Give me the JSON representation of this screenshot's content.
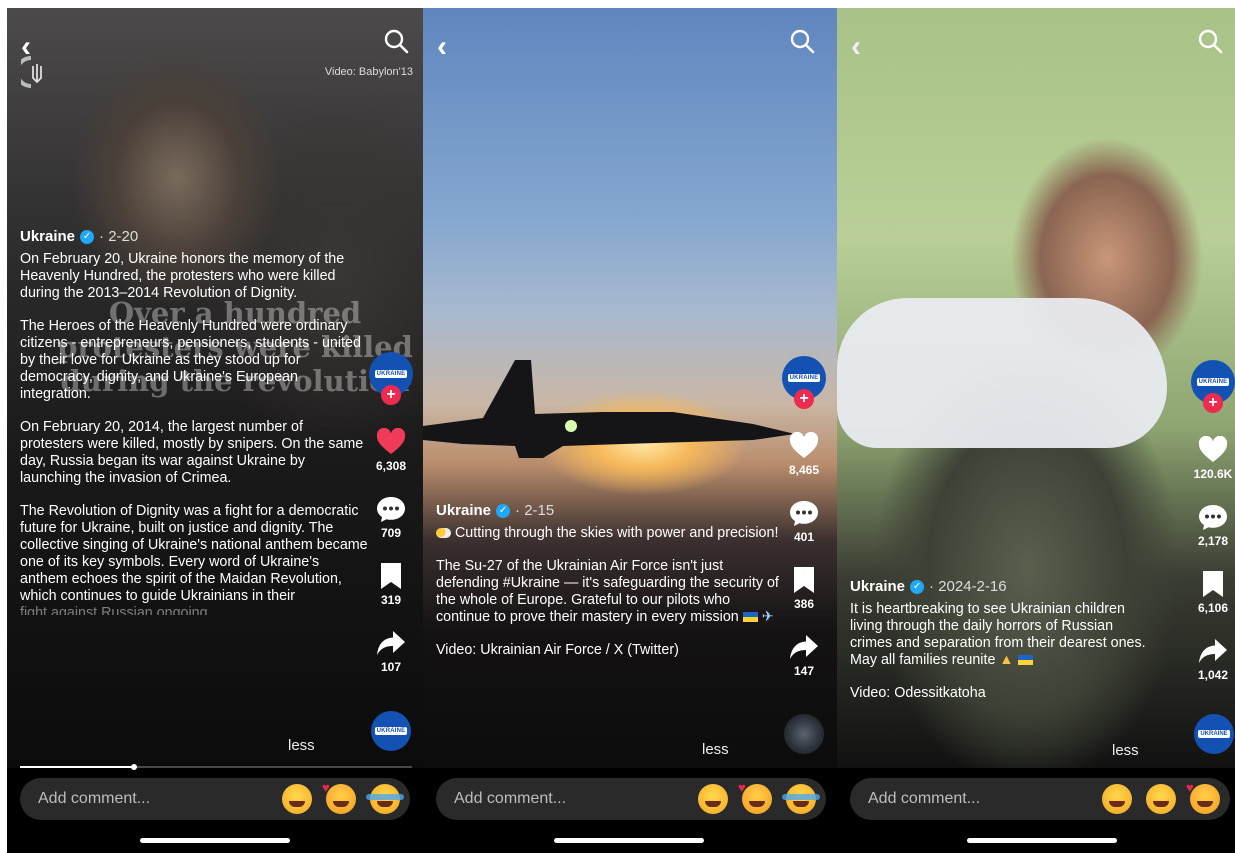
{
  "screens": [
    {
      "credit_top": "Video: Babylon'13",
      "overlay_text": "Over a hundred protesters were killed during the revolution",
      "author": "Ukraine",
      "date": "· 2-20",
      "paragraphs": [
        "On February 20, Ukraine honors the memory of the Heavenly Hundred, the protesters who were killed during the 2013–2014 Revolution of Dignity.",
        "The Heroes of the Heavenly Hundred were ordinary citizens - entrepreneurs, pensioners, students - united by their love for Ukraine as they stood up for democracy, dignity, and Ukraine's European integration.",
        "On February 20, 2014, the largest number of protesters were killed, mostly by snipers. On the same day, Russia began its war against Ukraine by launching the invasion of Crimea.",
        "The Revolution of Dignity was a fight for a democratic future for Ukraine, built on justice and dignity. The collective singing of Ukraine's national anthem became one of its key symbols. Every word of Ukraine's anthem echoes the spirit of the Maidan Revolution, which continues to guide Ukrainians in their",
        "fight against Russian ongoing"
      ],
      "less": "less",
      "avatar_tag": "UKRAINE",
      "likes": "6,308",
      "comments": "709",
      "saves": "319",
      "shares": "107",
      "progress": 0.29,
      "comment_placeholder": "Add comment...",
      "emojis": [
        "grinning-face",
        "smiling-face-with-hearts",
        "face-with-tears-of-joy"
      ]
    },
    {
      "author": "Ukraine",
      "date": "· 2-15",
      "paragraphs": [
        "Cutting through the skies with power and precision!",
        "The Su-27 of the Ukrainian Air Force isn't just defending #Ukraine — it's safeguarding the security of the whole of Europe. Grateful to our pilots who continue to prove their mastery in every mission",
        "Video: Ukrainian Air Force / X (Twitter)"
      ],
      "less": "less",
      "avatar_tag": "UKRAINE",
      "likes": "8,465",
      "comments": "401",
      "saves": "386",
      "shares": "147",
      "comment_placeholder": "Add comment...",
      "emojis": [
        "grinning-face",
        "smiling-face-with-hearts",
        "face-with-tears-of-joy"
      ]
    },
    {
      "author": "Ukraine",
      "date": "· 2024-2-16",
      "paragraphs": [
        "It is heartbreaking to see Ukrainian children living through the daily horrors of Russian crimes and separation from their dearest ones. May all families reunite",
        "Video: Odessitkatoha"
      ],
      "less": "less",
      "avatar_tag": "UKRAINE",
      "likes": "120.6K",
      "comments": "2,178",
      "saves": "6,106",
      "shares": "1,042",
      "comment_placeholder": "Add comment...",
      "emojis": [
        "pleading-face",
        "grinning-face",
        "smiling-face-with-hearts"
      ]
    }
  ],
  "colors": {
    "like_active": "#f03a5a",
    "verified": "#20a7f5",
    "avatar_bg": "#1352b3",
    "follow_badge": "#ee2a4f"
  }
}
